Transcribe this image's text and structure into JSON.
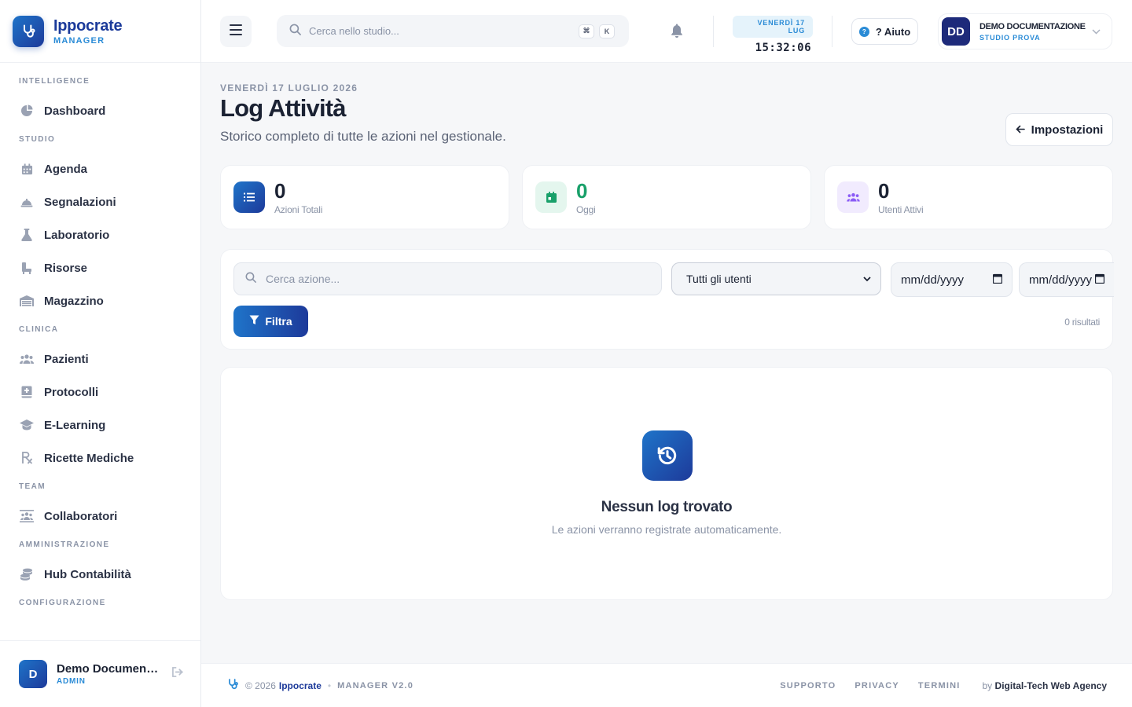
{
  "brand": {
    "name": "Ippocrate",
    "subtitle": "MANAGER"
  },
  "sidebar": {
    "sections": [
      {
        "title": "INTELLIGENCE",
        "items": [
          {
            "label": "Dashboard",
            "icon": "pie-chart-icon"
          }
        ]
      },
      {
        "title": "STUDIO",
        "items": [
          {
            "label": "Agenda",
            "icon": "calendar-icon"
          },
          {
            "label": "Segnalazioni",
            "icon": "bell-concierge-icon"
          },
          {
            "label": "Laboratorio",
            "icon": "flask-icon"
          },
          {
            "label": "Risorse",
            "icon": "chair-icon"
          },
          {
            "label": "Magazzino",
            "icon": "warehouse-icon"
          }
        ]
      },
      {
        "title": "CLINICA",
        "items": [
          {
            "label": "Pazienti",
            "icon": "users-icon"
          },
          {
            "label": "Protocolli",
            "icon": "protocol-book-icon"
          },
          {
            "label": "E-Learning",
            "icon": "graduation-cap-icon"
          },
          {
            "label": "Ricette Mediche",
            "icon": "prescription-icon"
          }
        ]
      },
      {
        "title": "TEAM",
        "items": [
          {
            "label": "Collaboratori",
            "icon": "team-icon"
          }
        ]
      },
      {
        "title": "AMMINISTRAZIONE",
        "items": [
          {
            "label": "Hub Contabilità",
            "icon": "coins-icon"
          }
        ]
      },
      {
        "title": "CONFIGURAZIONE",
        "items": []
      }
    ],
    "user": {
      "initial": "D",
      "name": "Demo Documentazione",
      "role": "ADMIN"
    }
  },
  "topbar": {
    "search_placeholder": "Cerca nello studio...",
    "shortcut_keys": [
      "⌘",
      "K"
    ],
    "date_pill": "VENERDÌ 17 LUG",
    "clock": "15:32:06",
    "help_label": "? Aiuto",
    "profile": {
      "initials": "DD",
      "name": "DEMO DOCUMENTAZIONE",
      "studio": "STUDIO PROVA"
    }
  },
  "page": {
    "date": "VENERDÌ 17 LUGLIO 2026",
    "title": "Log Attività",
    "subtitle": "Storico completo di tutte le azioni nel gestionale.",
    "back_button": "Impostazioni"
  },
  "stats": [
    {
      "value": "0",
      "label": "Azioni Totali",
      "color": "#1b2233"
    },
    {
      "value": "0",
      "label": "Oggi",
      "color": "#19a06a"
    },
    {
      "value": "0",
      "label": "Utenti Attivi",
      "color": "#1b2233"
    }
  ],
  "filters": {
    "search_placeholder": "Cerca azione...",
    "user_select_value": "Tutti gli utenti",
    "date_from_placeholder": "mm/dd/yyyy",
    "date_to_placeholder": "mm/dd/yyyy",
    "filter_button": "Filtra",
    "results_count": "0 risultati"
  },
  "empty": {
    "title": "Nessun log trovato",
    "subtitle": "Le azioni verranno registrate automaticamente."
  },
  "footer": {
    "copyright": "© 2026",
    "brand": "Ippocrate",
    "version": "MANAGER V2.0",
    "links": [
      "SUPPORTO",
      "PRIVACY",
      "TERMINI"
    ],
    "by_prefix": "by",
    "agency": "Digital-Tech Web Agency"
  },
  "colors": {
    "accent": "#1d3a9a",
    "accent_light": "#2a8bd6",
    "success": "#19a06a",
    "purple": "#8b5cf6"
  }
}
